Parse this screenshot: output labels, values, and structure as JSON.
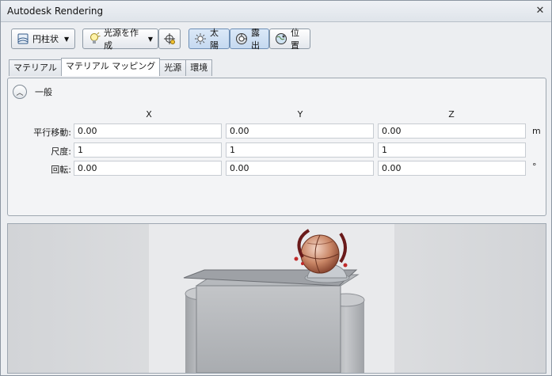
{
  "window": {
    "title": "Autodesk Rendering",
    "close_glyph": "✕"
  },
  "toolbar": {
    "cylinder_label": "円柱状",
    "create_light_label": "光源を作成",
    "sun_label": "太陽",
    "exposure_label": "露出",
    "location_label": "位置"
  },
  "tabs": [
    {
      "label": "マテリアル",
      "active": false
    },
    {
      "label": "マテリアル マッピング",
      "active": true
    },
    {
      "label": "光源",
      "active": false
    },
    {
      "label": "環境",
      "active": false
    }
  ],
  "section": {
    "title": "一般"
  },
  "columns": [
    "X",
    "Y",
    "Z"
  ],
  "rows": [
    {
      "label": "平行移動:",
      "values": [
        "0.00",
        "0.00",
        "0.00"
      ],
      "unit": "m"
    },
    {
      "label": "尺度:",
      "values": [
        "1",
        "1",
        "1"
      ],
      "unit": ""
    },
    {
      "label": "回転:",
      "values": [
        "0.00",
        "0.00",
        "0.00"
      ],
      "unit": "°"
    }
  ]
}
